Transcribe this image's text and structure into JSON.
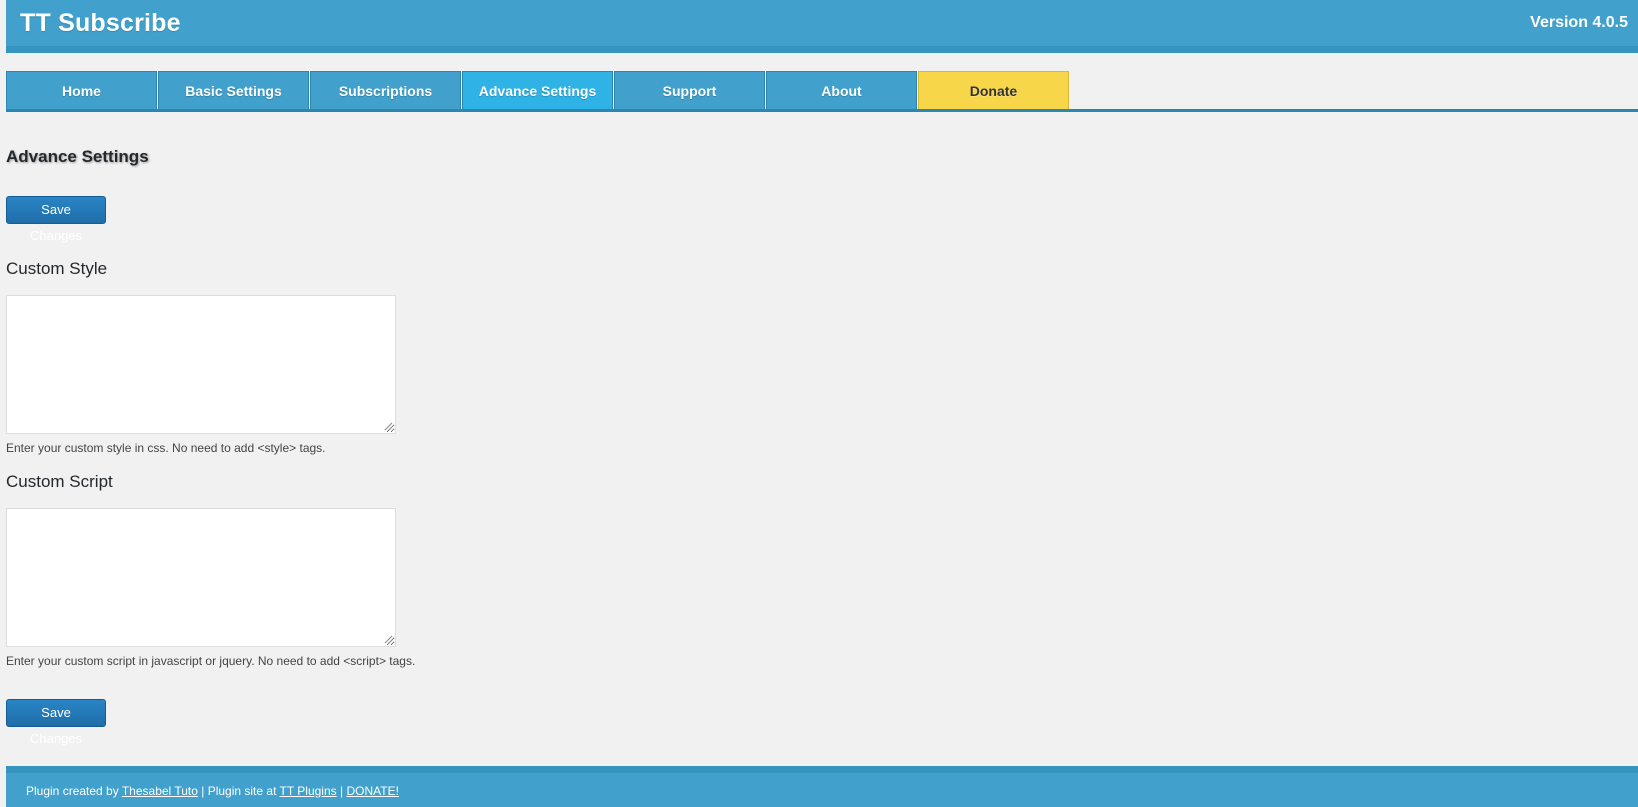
{
  "header": {
    "title": "TT Subscribe",
    "version": "Version 4.0.5"
  },
  "tabs": [
    {
      "label": "Home"
    },
    {
      "label": "Basic Settings"
    },
    {
      "label": "Subscriptions"
    },
    {
      "label": "Advance Settings",
      "active": true
    },
    {
      "label": "Support"
    },
    {
      "label": "About"
    },
    {
      "label": "Donate"
    }
  ],
  "main": {
    "title": "Advance Settings",
    "save_label": "Save Changes",
    "custom_style": {
      "label": "Custom Style",
      "value": "",
      "help": "Enter your custom style in css. No need to add <style> tags."
    },
    "custom_script": {
      "label": "Custom Script",
      "value": "",
      "help": "Enter your custom script in javascript or jquery. No need to add <script> tags."
    }
  },
  "footer": {
    "prefix": "Plugin created by ",
    "author_link": "Thesabel Tuto",
    "mid": " | Plugin site at ",
    "site_link": "TT Plugins",
    "sep": " | ",
    "donate_link": "DONATE!"
  },
  "colors": {
    "header": "#41a1cc",
    "tab_active": "#2fb3e6",
    "donate": "#f8d64a",
    "button": "#2271b1"
  }
}
